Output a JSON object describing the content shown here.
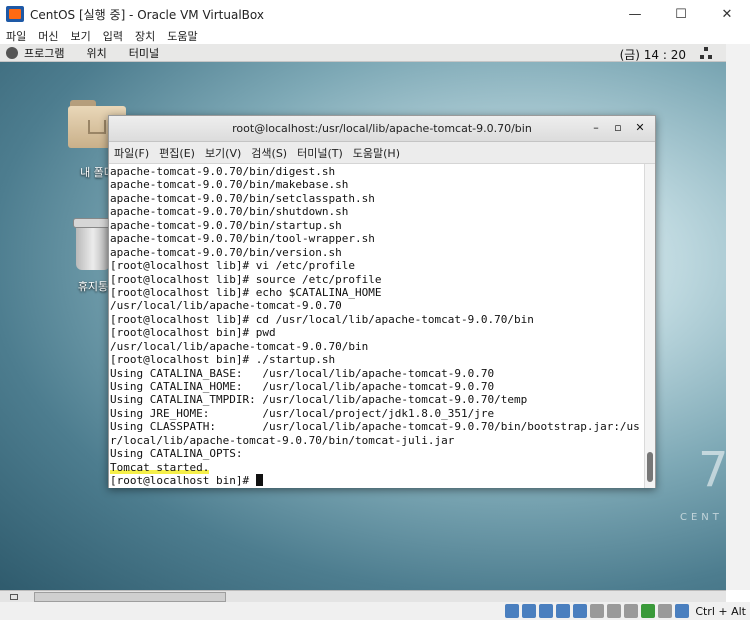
{
  "host_window": {
    "title": "CentOS [실행 중] - Oracle VM VirtualBox",
    "minimize": "—",
    "maximize": "☐",
    "close": "✕"
  },
  "vbox_menu": [
    "파일",
    "머신",
    "보기",
    "입력",
    "장치",
    "도움말"
  ],
  "gnome_panel": {
    "menus": [
      "프로그램",
      "위치",
      "터미널"
    ],
    "clock": "(금) 14 : 20"
  },
  "desktop_icons": [
    {
      "label": "내 폴더",
      "icon": "home-folder-icon"
    },
    {
      "label": "휴지통",
      "icon": "trash-icon"
    }
  ],
  "desktop_watermark": {
    "number": "7",
    "word": "CENT"
  },
  "terminal": {
    "title": "root@localhost:/usr/local/lib/apache-tomcat-9.0.70/bin",
    "menus": [
      "파일(F)",
      "편집(E)",
      "보기(V)",
      "검색(S)",
      "터미널(T)",
      "도움말(H)"
    ],
    "lines": [
      "apache-tomcat-9.0.70/bin/digest.sh",
      "apache-tomcat-9.0.70/bin/makebase.sh",
      "apache-tomcat-9.0.70/bin/setclasspath.sh",
      "apache-tomcat-9.0.70/bin/shutdown.sh",
      "apache-tomcat-9.0.70/bin/startup.sh",
      "apache-tomcat-9.0.70/bin/tool-wrapper.sh",
      "apache-tomcat-9.0.70/bin/version.sh",
      "[root@localhost lib]# vi /etc/profile",
      "[root@localhost lib]# source /etc/profile",
      "[root@localhost lib]# echo $CATALINA_HOME",
      "/usr/local/lib/apache-tomcat-9.0.70",
      "[root@localhost lib]# cd /usr/local/lib/apache-tomcat-9.0.70/bin",
      "[root@localhost bin]# pwd",
      "/usr/local/lib/apache-tomcat-9.0.70/bin",
      "[root@localhost bin]# ./startup.sh",
      "Using CATALINA_BASE:   /usr/local/lib/apache-tomcat-9.0.70",
      "Using CATALINA_HOME:   /usr/local/lib/apache-tomcat-9.0.70",
      "Using CATALINA_TMPDIR: /usr/local/lib/apache-tomcat-9.0.70/temp",
      "Using JRE_HOME:        /usr/local/project/jdk1.8.0_351/jre",
      "Using CLASSPATH:       /usr/local/lib/apache-tomcat-9.0.70/bin/bootstrap.jar:/us",
      "r/local/lib/apache-tomcat-9.0.70/bin/tomcat-juli.jar",
      "Using CATALINA_OPTS:",
      "Tomcat started."
    ],
    "prompt": "[root@localhost bin]# "
  },
  "status_bar": {
    "host_key": "Ctrl + Alt"
  }
}
